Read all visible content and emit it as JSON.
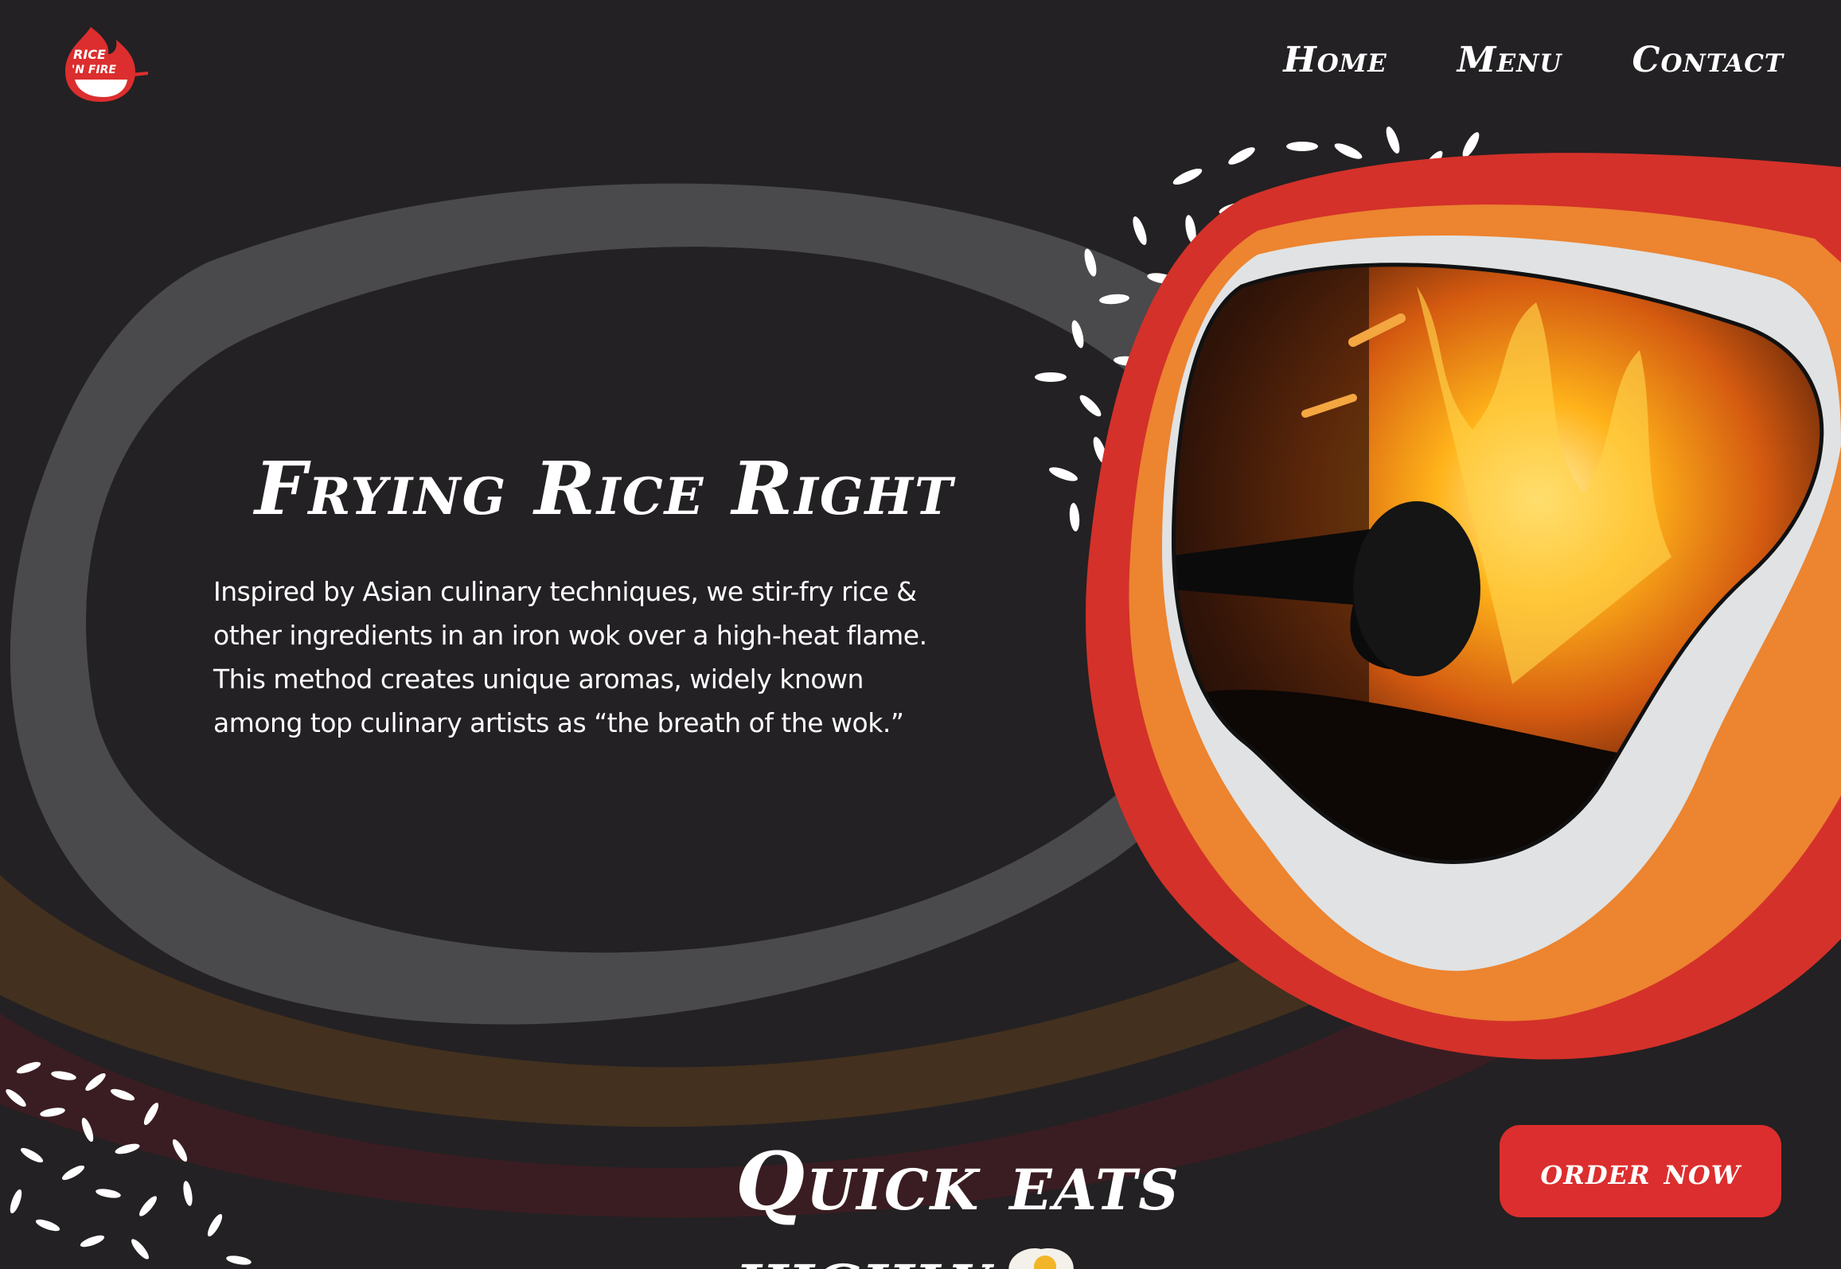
{
  "brand": {
    "logo_text_line1": "RICE",
    "logo_text_line2": "'N FIRE",
    "logo_icon": "flame-bowl-logo",
    "accent_color": "#dc2e2e",
    "orange_color": "#ec8430",
    "background_color": "#232123"
  },
  "nav": {
    "items": [
      {
        "label": "Home"
      },
      {
        "label": "Menu"
      },
      {
        "label": "Contact"
      }
    ]
  },
  "hero": {
    "title": "Frying Rice Right",
    "description": "Inspired by Asian culinary techniques, we stir-fry rice & other ingredients in an iron wok over a high-heat flame. This method creates unique aromas, widely known among top culinary artists as “the breath of the wok.”",
    "image_icon": "wok-flame-photo"
  },
  "quick": {
    "title_line1": "Quick eats",
    "title_line2": "highly",
    "icon": "fried-egg-icon"
  },
  "cta": {
    "order_label": "order now"
  }
}
